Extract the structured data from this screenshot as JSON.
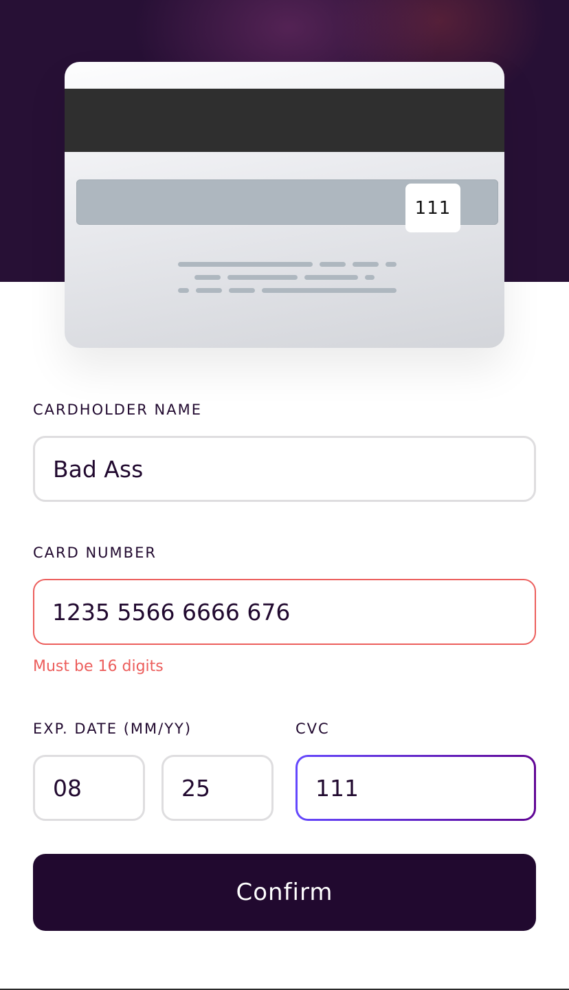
{
  "card_preview": {
    "cvc": "111"
  },
  "form": {
    "cardholder": {
      "label": "CARDHOLDER NAME",
      "value": "Bad Ass"
    },
    "card_number": {
      "label": "CARD NUMBER",
      "value": "1235 5566 6666 676",
      "error": "Must be 16 digits"
    },
    "expiry": {
      "label": "EXP. DATE (MM/YY)",
      "month": "08",
      "year": "25"
    },
    "cvc": {
      "label": "CVC",
      "value": "111"
    },
    "confirm_label": "Confirm"
  },
  "colors": {
    "dark_violet": "#21092f",
    "error_red": "#ec5d5b",
    "input_border": "#dedddf",
    "focus_gradient_start": "#6448fe",
    "focus_gradient_end": "#600594"
  }
}
